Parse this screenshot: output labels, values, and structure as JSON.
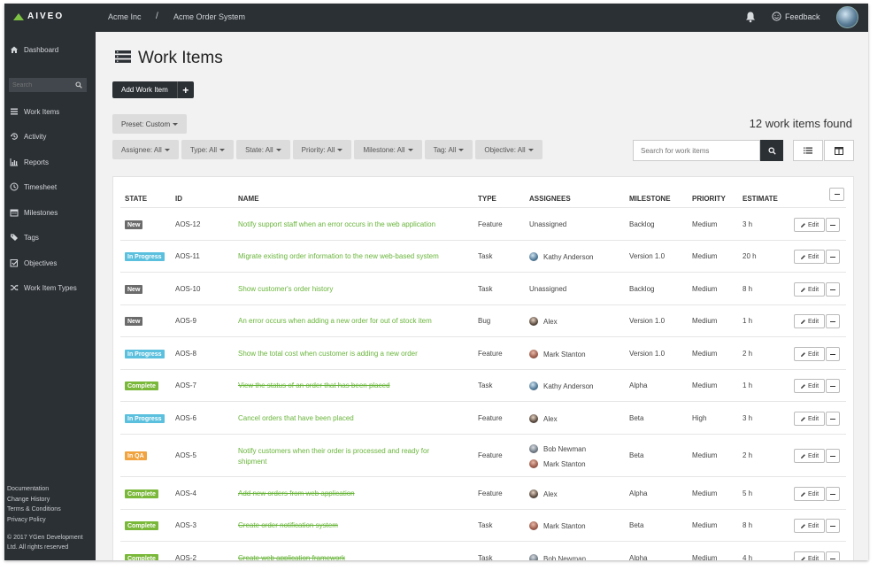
{
  "app": {
    "logo": "AIVEO"
  },
  "breadcrumb": {
    "org": "Acme Inc",
    "separator": "/",
    "project": "Acme Order System"
  },
  "topbar": {
    "feedback": "Feedback"
  },
  "sidebar": {
    "items": [
      {
        "label": "Dashboard",
        "icon": "home-icon"
      },
      {
        "label": "Work Items",
        "icon": "list-icon"
      },
      {
        "label": "Activity",
        "icon": "history-icon"
      },
      {
        "label": "Reports",
        "icon": "bar-chart-icon"
      },
      {
        "label": "Timesheet",
        "icon": "clock-icon"
      },
      {
        "label": "Milestones",
        "icon": "calendar-icon"
      },
      {
        "label": "Tags",
        "icon": "tags-icon"
      },
      {
        "label": "Objectives",
        "icon": "check-square-icon"
      },
      {
        "label": "Work Item Types",
        "icon": "shuffle-icon"
      }
    ],
    "search_placeholder": "Search",
    "footer_links": [
      "Documentation",
      "Change History",
      "Terms & Conditions",
      "Privacy Policy"
    ],
    "copyright_1": "© 2017 YGen Development",
    "copyright_2": "Ltd. All rights reserved"
  },
  "page": {
    "title": "Work Items",
    "add_label": "Add Work Item",
    "add_plus": "+",
    "preset": "Preset: Custom",
    "found": "12 work items found",
    "filters": [
      "Assignee: All",
      "Type: All",
      "State: All",
      "Priority: All",
      "Milestone: All",
      "Tag: All",
      "Objective: All"
    ],
    "search_placeholder": "Search for work items"
  },
  "table": {
    "headers": [
      "STATE",
      "ID",
      "NAME",
      "TYPE",
      "ASSIGNEES",
      "MILESTONE",
      "PRIORITY",
      "ESTIMATE"
    ],
    "edit_label": "Edit",
    "rows": [
      {
        "state": "New",
        "id": "AOS-12",
        "name": "Notify support staff when an error occurs in the web application",
        "type": "Feature",
        "assignees": [
          "Unassigned"
        ],
        "milestone": "Backlog",
        "priority": "Medium",
        "estimate": "3 h"
      },
      {
        "state": "In Progress",
        "id": "AOS-11",
        "name": "Migrate existing order information to the new web-based system",
        "type": "Task",
        "assignees": [
          "Kathy Anderson"
        ],
        "milestone": "Version 1.0",
        "priority": "Medium",
        "estimate": "20 h"
      },
      {
        "state": "New",
        "id": "AOS-10",
        "name": "Show customer's order history",
        "type": "Task",
        "assignees": [
          "Unassigned"
        ],
        "milestone": "Backlog",
        "priority": "Medium",
        "estimate": "8 h"
      },
      {
        "state": "New",
        "id": "AOS-9",
        "name": "An error occurs when adding a new order for out of stock item",
        "type": "Bug",
        "assignees": [
          "Alex"
        ],
        "milestone": "Version 1.0",
        "priority": "Medium",
        "estimate": "1 h"
      },
      {
        "state": "In Progress",
        "id": "AOS-8",
        "name": "Show the total cost when customer is adding a new order",
        "type": "Feature",
        "assignees": [
          "Mark Stanton"
        ],
        "milestone": "Version 1.0",
        "priority": "Medium",
        "estimate": "2 h"
      },
      {
        "state": "Complete",
        "id": "AOS-7",
        "name": "View the status of an order that has been placed",
        "type": "Task",
        "assignees": [
          "Kathy Anderson"
        ],
        "milestone": "Alpha",
        "priority": "Medium",
        "estimate": "1 h"
      },
      {
        "state": "In Progress",
        "id": "AOS-6",
        "name": "Cancel orders that have been placed",
        "type": "Feature",
        "assignees": [
          "Alex"
        ],
        "milestone": "Beta",
        "priority": "High",
        "estimate": "3 h"
      },
      {
        "state": "In QA",
        "id": "AOS-5",
        "name": "Notify customers when their order is processed and ready for shipment",
        "type": "Feature",
        "assignees": [
          "Bob Newman",
          "Mark Stanton"
        ],
        "milestone": "Beta",
        "priority": "Medium",
        "estimate": "2 h"
      },
      {
        "state": "Complete",
        "id": "AOS-4",
        "name": "Add new orders from web application",
        "type": "Feature",
        "assignees": [
          "Alex"
        ],
        "milestone": "Alpha",
        "priority": "Medium",
        "estimate": "5 h"
      },
      {
        "state": "Complete",
        "id": "AOS-3",
        "name": "Create order notification system",
        "type": "Task",
        "assignees": [
          "Mark Stanton"
        ],
        "milestone": "Beta",
        "priority": "Medium",
        "estimate": "8 h"
      },
      {
        "state": "Complete",
        "id": "AOS-2",
        "name": "Create web application framework",
        "type": "Task",
        "assignees": [
          "Bob Newman"
        ],
        "milestone": "Alpha",
        "priority": "Medium",
        "estimate": "4 h"
      }
    ]
  },
  "colors": {
    "state_new": "#6b6b6b",
    "state_in_progress": "#5bc0de",
    "state_complete": "#7ab83a",
    "state_in_qa": "#f0a33e",
    "link": "#69b53b",
    "dark": "#2b3035"
  }
}
